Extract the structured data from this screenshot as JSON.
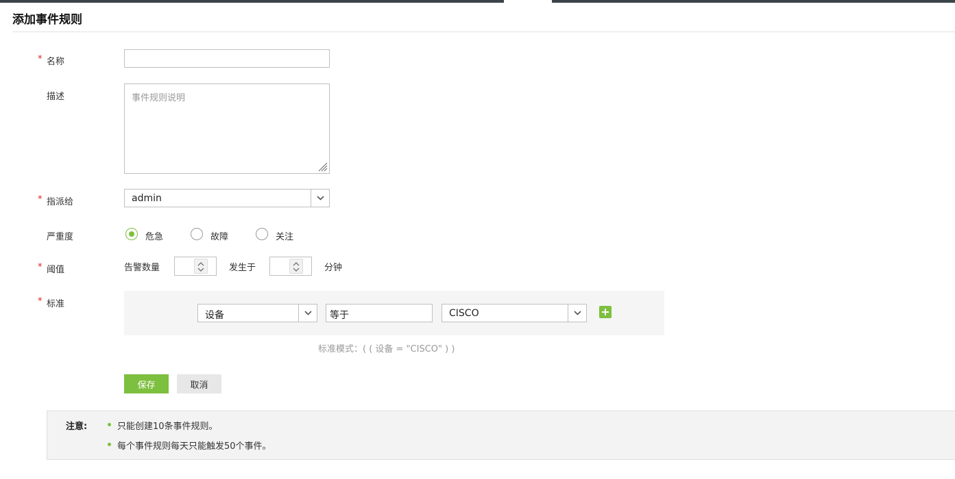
{
  "page": {
    "title": "添加事件规则"
  },
  "form": {
    "name": {
      "label": "名称",
      "required_mark": "*",
      "value": ""
    },
    "description": {
      "label": "描述",
      "placeholder": "事件规则说明"
    },
    "assign": {
      "label": "指派给",
      "required_mark": "*",
      "value": "admin"
    },
    "severity": {
      "label": "严重度",
      "options": [
        {
          "label": "危急",
          "selected": true
        },
        {
          "label": "故障",
          "selected": false
        },
        {
          "label": "关注",
          "selected": false
        }
      ]
    },
    "threshold": {
      "label": "阈值",
      "required_mark": "*",
      "alarm_count_label": "告警数量",
      "occurs_in_label": "发生于",
      "minutes_label": "分钟"
    },
    "criteria": {
      "label": "标准",
      "required_mark": "*",
      "field": "设备",
      "operator": "等于",
      "value": "CISCO",
      "pattern": "标准模式：( ( 设备 = \"CISCO\" ) )"
    }
  },
  "buttons": {
    "save": "保存",
    "cancel": "取消"
  },
  "note": {
    "title": "注意:",
    "items": [
      "只能创建10条事件规则。",
      "每个事件规则每天只能触发50个事件。"
    ]
  },
  "colors": {
    "accent": "#7dbf3e",
    "required": "#e02020",
    "topbar": "#3b4449"
  }
}
